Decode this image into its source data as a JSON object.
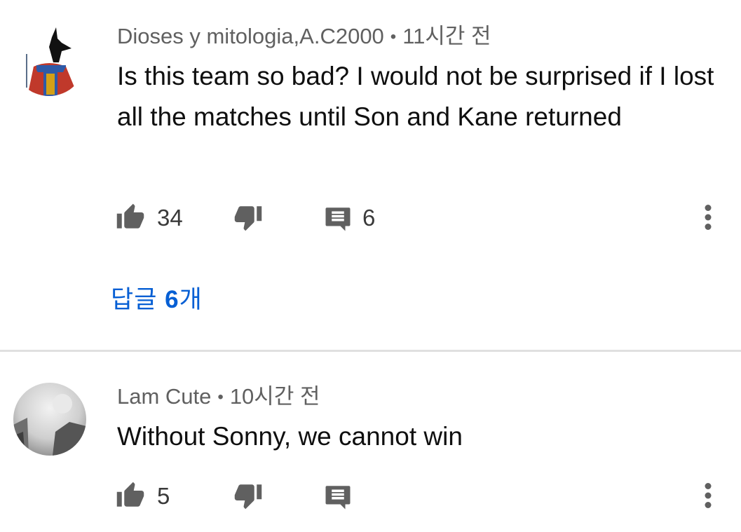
{
  "comments": [
    {
      "author": "Dioses y mitologia,A.C2000",
      "separator": "•",
      "time": "11시간 전",
      "text": "Is this team so bad? I would not be surprised if I lost all the matches until Son and Kane returned",
      "likes": "34",
      "replies_count": "6",
      "replies_link": {
        "prefix": "답글 ",
        "count": "6",
        "suffix": "개"
      },
      "avatar_icon": "anubis-avatar"
    },
    {
      "author": "Lam Cute",
      "separator": "•",
      "time": "10시간 전",
      "text": "Without Sonny, we cannot win",
      "likes": "5",
      "avatar_icon": "grayscale-photo-avatar"
    }
  ],
  "colors": {
    "text": "#0f0f0f",
    "meta": "#606060",
    "icon": "#606060",
    "link": "#065fd4",
    "divider": "#e0e0e0"
  }
}
